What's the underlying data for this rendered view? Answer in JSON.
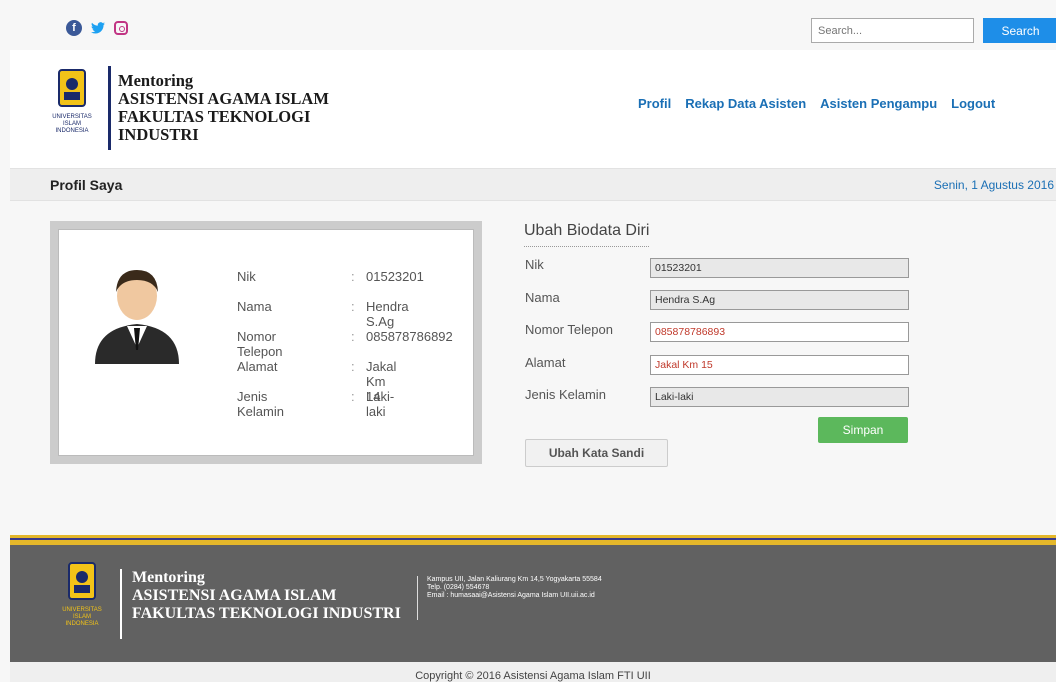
{
  "social": {
    "icons": [
      "facebook-icon",
      "twitter-icon",
      "instagram-icon"
    ],
    "facebook_glyph": "f",
    "twitter_glyph": "🐦"
  },
  "search": {
    "placeholder": "Search...",
    "button_label": "Search"
  },
  "brand": {
    "line1": "Mentoring",
    "line2": "ASISTENSI AGAMA ISLAM",
    "line3": "FAKULTAS TEKNOLOGI",
    "line4": "INDUSTRI",
    "logo_text": [
      "UNIVERSITAS",
      "ISLAM",
      "INDONESIA"
    ]
  },
  "nav": {
    "items": [
      "Profil",
      "Rekap Data Asisten",
      "Asisten Pengampu",
      "Logout"
    ]
  },
  "pagebar": {
    "title": "Profil Saya",
    "date": "Senin, 1 Agustus 2016"
  },
  "profile": {
    "rows": [
      {
        "label": "Nik",
        "value": "01523201"
      },
      {
        "label": "Nama",
        "value": "Hendra S.Ag"
      },
      {
        "label": "Nomor Telepon",
        "value": "085878786892"
      },
      {
        "label": "Alamat",
        "value": "Jakal Km 14"
      },
      {
        "label": "Jenis Kelamin",
        "value": "Laki-laki"
      }
    ],
    "colon": ":"
  },
  "form": {
    "title": "Ubah Biodata Diri",
    "fields": [
      {
        "label": "Nik",
        "value": "01523201"
      },
      {
        "label": "Nama",
        "value": "Hendra S.Ag"
      },
      {
        "label": "Nomor Telepon",
        "value": "085878786893"
      },
      {
        "label": "Alamat",
        "value": "Jakal Km 15"
      },
      {
        "label": "Jenis Kelamin",
        "value": "Laki-laki"
      }
    ],
    "save_label": "Simpan",
    "change_password_label": "Ubah Kata Sandi"
  },
  "footer": {
    "line1": "Mentoring",
    "line2": "ASISTENSI AGAMA ISLAM",
    "line3": "FAKULTAS TEKNOLOGI INDUSTRI",
    "address": "Kampus UII, Jalan Kaliurang Km 14,5 Yogyakarta 55584",
    "phone": "Telp. (0284) 554678",
    "email": "Email : humasaai@Asistensi Agama Islam UII.uii.ac.id",
    "copyright": "Copyright © 2016 Asistensi Agama Islam FTI UII"
  },
  "colors": {
    "accent": "#1e8ee8",
    "link": "#1a6fb5",
    "save": "#5cb85c",
    "footer": "#616161",
    "stripe": "#e4b72a"
  }
}
